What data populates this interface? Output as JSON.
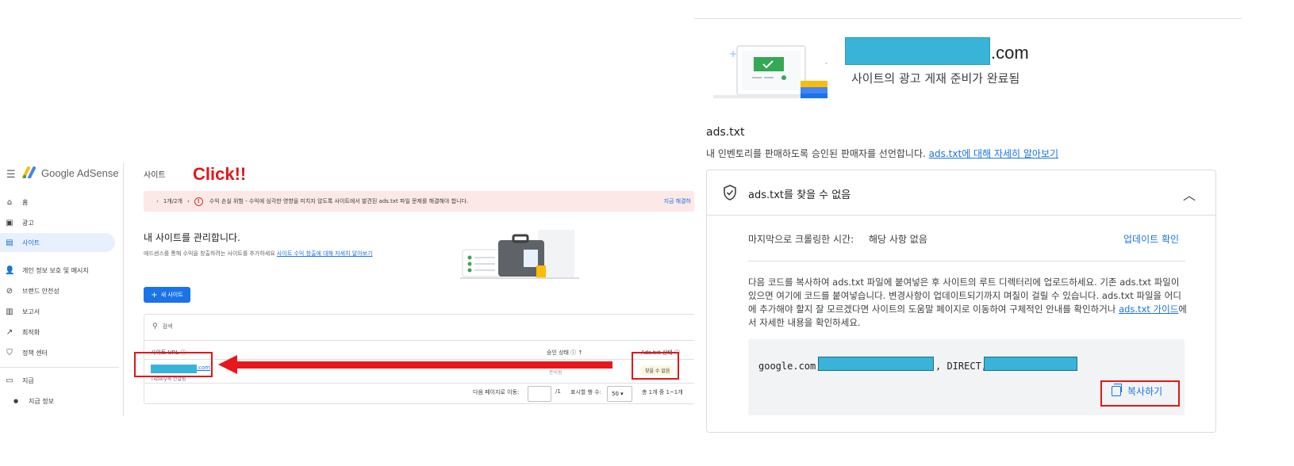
{
  "left": {
    "app_name": "Google AdSense",
    "page_title": "사이트",
    "nav": [
      {
        "label": "홈",
        "icon": "home-icon"
      },
      {
        "label": "광고",
        "icon": "ads-icon"
      },
      {
        "label": "사이트",
        "icon": "sites-icon",
        "active": true
      },
      {
        "label": "개인 정보 보호 및 메시지",
        "icon": "privacy-icon"
      },
      {
        "label": "브랜드 안전성",
        "icon": "block-icon"
      },
      {
        "label": "보고서",
        "icon": "report-icon"
      },
      {
        "label": "최적화",
        "icon": "trend-icon"
      },
      {
        "label": "정책 센터",
        "icon": "shield-icon"
      },
      {
        "label": "지급",
        "icon": "payment-icon"
      },
      {
        "label": "지급 정보",
        "icon": "dot-icon"
      }
    ],
    "alert": {
      "page": "1개/2개",
      "message": "수익 손실 위험 - 수익에 심각한 영향을 미치지 않도록 사이트에서 발견된 ads.txt 파일 문제를 해결해야 합니다.",
      "action": "지금 해결하"
    },
    "section_title": "내 사이트를 관리합니다.",
    "section_desc": "애드센스를 통해 수익을 창출하려는 사이트를 추가하세요",
    "section_link": "사이트 수익 창출에 대해 자세히 알아보기",
    "new_site_button": "새 사이트",
    "search_placeholder": "검색",
    "columns": [
      "사이트 URL",
      "승인 상태",
      "Ads.txt 상태"
    ],
    "row": {
      "url_tld": ".com",
      "sub": "Tistory에 연결됨",
      "approval": "준비됨",
      "ads_status": "찾을 수 없음"
    },
    "pager": {
      "goto_label": "다음 페이지로 이동:",
      "total_pages": "/1",
      "rows_label": "표시할 행 수:",
      "rows_value": "50",
      "summary": "총 1개 중 1~1개"
    },
    "annotation": "Click!!",
    "annotation_color": "#e0171b"
  },
  "right": {
    "domain_tld": ".com",
    "ready_text": "사이트의 광고 게재 준비가 완료됨",
    "ads_title": "ads.txt",
    "ads_desc": "내 인벤토리를 판매하도록 승인된 판매자를 선언합니다.",
    "ads_link": "ads.txt에 대해 자세히 알아보기",
    "card_title": "ads.txt를 찾을 수 없음",
    "crawl_label": "마지막으로 크롤링한 시간:",
    "crawl_value": "해당 사항 없음",
    "check_update": "업데이트 확인",
    "instructions": "다음 코드를 복사하여 ads.txt 파일에 붙여넣은 후 사이트의 루트 디렉터리에 업로드하세요. 기존 ads.txt 파일이 있으면 여기에 코드를 붙여넣습니다. 변경사항이 업데이트되기까지 며칠이 걸릴 수 있습니다. ads.txt 파일을 어디에 추가해야 할지 잘 모르겠다면 사이트의 도움말 페이지로 이동하여 구체적인 안내를 확인하거나 ",
    "instructions_link": "ads.txt 가이드",
    "instructions_tail": "에서 자세한 내용을 확인하세요.",
    "code_prefix": "google.com,",
    "code_mid": ", DIRECT,",
    "copy_button": "복사하기"
  },
  "colors": {
    "accent": "#1a73e8",
    "redaction": "#39b4d8",
    "highlight": "#e0171b",
    "alert_bg": "#fce8e6"
  }
}
